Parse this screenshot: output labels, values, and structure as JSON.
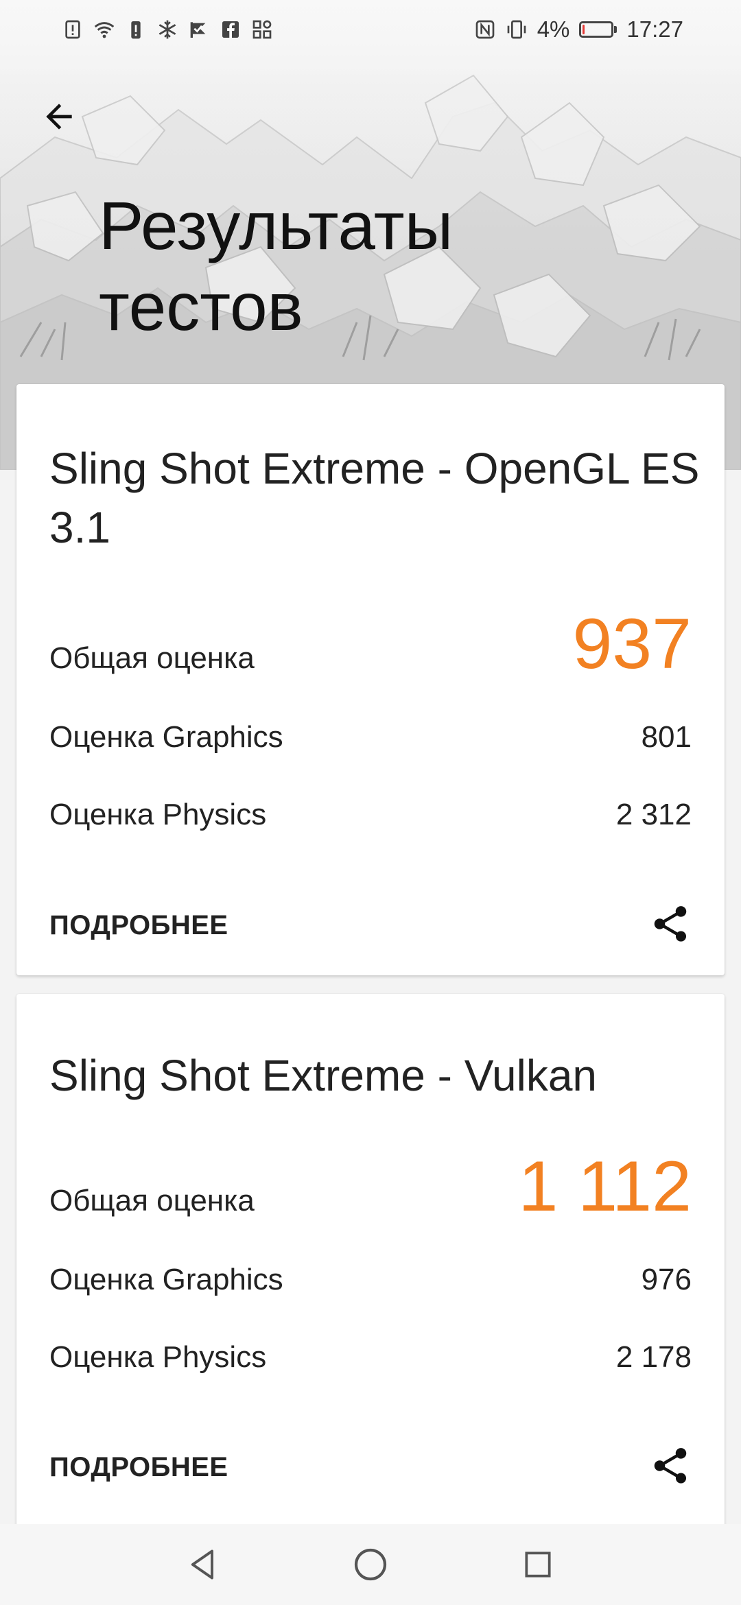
{
  "status_bar": {
    "left_icons": [
      "sim-alert-icon",
      "wifi-icon",
      "storage-alert-icon",
      "snowflake-icon",
      "check-flag-icon",
      "facebook-icon",
      "apps-icon"
    ],
    "right_icons": [
      "nfc-icon",
      "vibrate-icon"
    ],
    "battery_percent": "4%",
    "battery_level": 0.04,
    "time": "17:27"
  },
  "header": {
    "back_icon": "arrow-back-icon",
    "title_line1": "Результаты",
    "title_line2": "тестов"
  },
  "results": [
    {
      "title": "Sling Shot Extreme - OpenGL ES 3.1",
      "overall_label": "Общая оценка",
      "overall_value": "937",
      "graphics_label": "Оценка Graphics",
      "graphics_value": "801",
      "physics_label": "Оценка Physics",
      "physics_value": "2 312",
      "details_label": "ПОДРОБНЕЕ",
      "share_icon": "share-icon"
    },
    {
      "title": "Sling Shot Extreme - Vulkan",
      "overall_label": "Общая оценка",
      "overall_value": "1 112",
      "graphics_label": "Оценка Graphics",
      "graphics_value": "976",
      "physics_label": "Оценка Physics",
      "physics_value": "2 178",
      "details_label": "ПОДРОБНЕЕ",
      "share_icon": "share-icon"
    }
  ],
  "nav_bar": {
    "back": "nav-back-icon",
    "home": "nav-home-icon",
    "recents": "nav-recents-icon"
  },
  "colors": {
    "accent": "#f28122",
    "background": "#f3f3f3",
    "card": "#ffffff"
  }
}
